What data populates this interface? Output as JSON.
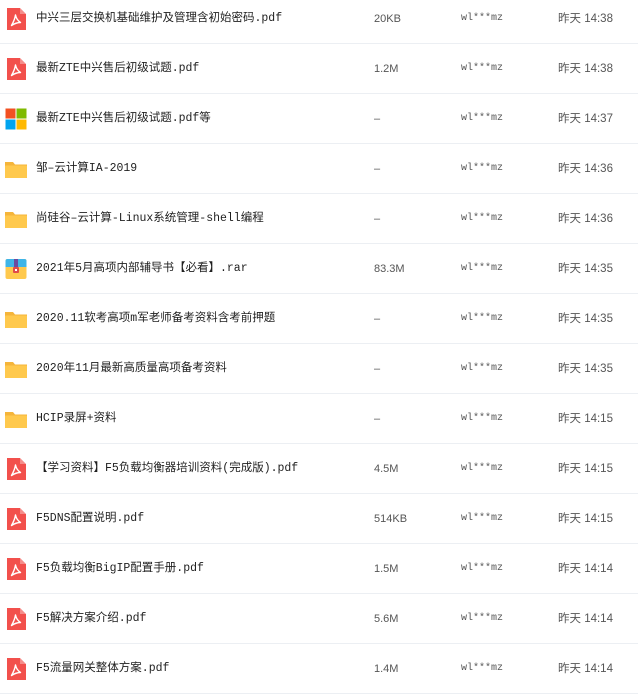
{
  "colors": {
    "pdf": "#f2504c",
    "folder": "#ffc94d",
    "folder_tab": "#f5b53a",
    "archive_top": "#3fb5e8",
    "archive_bottom": "#ffc94d",
    "mixed": [
      "#f25022",
      "#7fba00",
      "#00a4ef",
      "#ffb900"
    ]
  },
  "files": [
    {
      "icon": "pdf-icon",
      "name": "中兴三层交换机基础维护及管理含初始密码.pdf",
      "size": "20KB",
      "owner": "wl***mz",
      "time": "昨天 14:38"
    },
    {
      "icon": "pdf-icon",
      "name": "最新ZTE中兴售后初级试题.pdf",
      "size": "1.2M",
      "owner": "wl***mz",
      "time": "昨天 14:38"
    },
    {
      "icon": "multi-file-icon",
      "name": "最新ZTE中兴售后初级试题.pdf等",
      "size": "–",
      "owner": "wl***mz",
      "time": "昨天 14:37"
    },
    {
      "icon": "folder-icon",
      "name": "邹–云计算IA-2019",
      "size": "–",
      "owner": "wl***mz",
      "time": "昨天 14:36"
    },
    {
      "icon": "folder-icon",
      "name": "尚硅谷–云计算-Linux系统管理-shell编程",
      "size": "–",
      "owner": "wl***mz",
      "time": "昨天 14:36"
    },
    {
      "icon": "archive-icon",
      "name": "2021年5月高项内部辅导书【必看】.rar",
      "size": "83.3M",
      "owner": "wl***mz",
      "time": "昨天 14:35"
    },
    {
      "icon": "folder-icon",
      "name": "2020.11软考高项m军老师备考资料含考前押题",
      "size": "–",
      "owner": "wl***mz",
      "time": "昨天 14:35"
    },
    {
      "icon": "folder-icon",
      "name": "2020年11月最新高质量高项备考资料",
      "size": "–",
      "owner": "wl***mz",
      "time": "昨天 14:35"
    },
    {
      "icon": "folder-icon",
      "name": "HCIP录屏+资料",
      "size": "–",
      "owner": "wl***mz",
      "time": "昨天 14:15"
    },
    {
      "icon": "pdf-icon",
      "name": "【学习资料】F5负载均衡器培训资料(完成版).pdf",
      "size": "4.5M",
      "owner": "wl***mz",
      "time": "昨天 14:15"
    },
    {
      "icon": "pdf-icon",
      "name": "F5DNS配置说明.pdf",
      "size": "514KB",
      "owner": "wl***mz",
      "time": "昨天 14:15"
    },
    {
      "icon": "pdf-icon",
      "name": "F5负载均衡BigIP配置手册.pdf",
      "size": "1.5M",
      "owner": "wl***mz",
      "time": "昨天 14:14"
    },
    {
      "icon": "pdf-icon",
      "name": "F5解决方案介绍.pdf",
      "size": "5.6M",
      "owner": "wl***mz",
      "time": "昨天 14:14"
    },
    {
      "icon": "pdf-icon",
      "name": "F5流量网关整体方案.pdf",
      "size": "1.4M",
      "owner": "wl***mz",
      "time": "昨天 14:14"
    }
  ]
}
